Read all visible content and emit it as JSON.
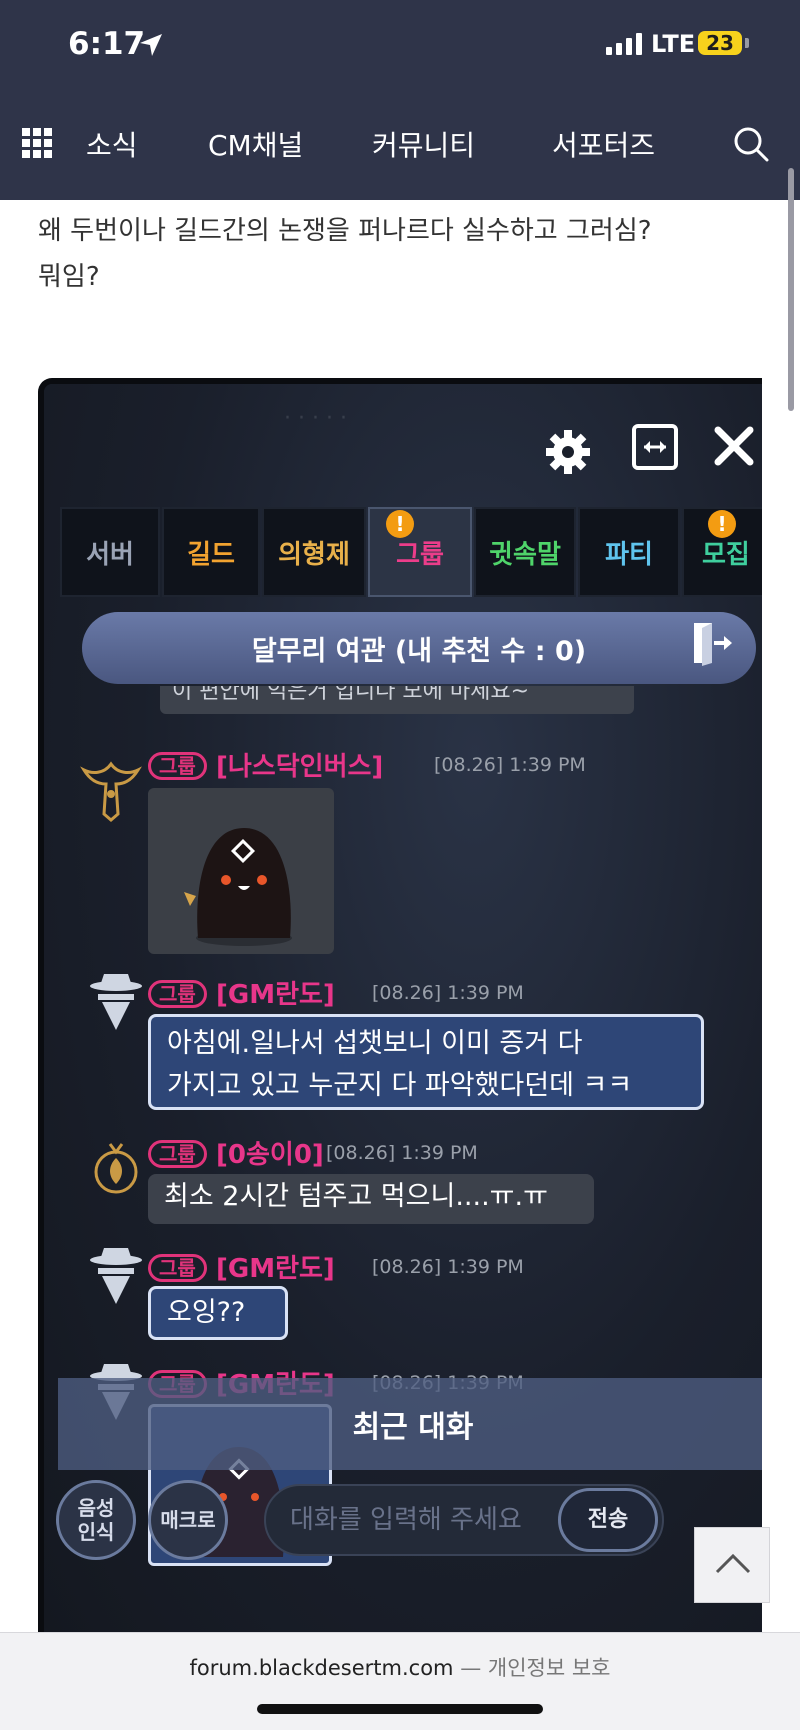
{
  "status": {
    "time": "6:17",
    "network": "LTE",
    "battery": "23"
  },
  "nav": {
    "items": [
      "소식",
      "CM채널",
      "커뮤니티",
      "서포터즈"
    ],
    "menu_icon": "grid-icon",
    "search_icon": "search-icon"
  },
  "post": {
    "line1": "왜 두번이나 길드간의 논쟁을 퍼나르다 실수하고 그러심?",
    "line2": "뭐임?"
  },
  "game": {
    "tabs": [
      {
        "label": "서버",
        "color": "#9aa3b5"
      },
      {
        "label": "길드",
        "color": "#f2a330"
      },
      {
        "label": "의형제",
        "color": "#e8b04a"
      },
      {
        "label": "그룹",
        "color": "#ec3d8a"
      },
      {
        "label": "귓속말",
        "color": "#4fd46a"
      },
      {
        "label": "파티",
        "color": "#5fc4ee"
      },
      {
        "label": "모집",
        "color": "#3fcf9e"
      }
    ],
    "room_title": "달무리 여관 (내 추천 수 : 0)",
    "cut_message": "이 편안에 익은거 입니다 모에 마세요~",
    "group_tag": "그룹",
    "messages": [
      {
        "name": "[나스닥인버스]",
        "time": "[08.26] 1:39 PM"
      },
      {
        "name": "[GM란도]",
        "time": "[08.26] 1:39 PM",
        "text_line1": "아침에.일나서 섭챗보니 이미 증거 다",
        "text_line2": "가지고 있고 누군지 다 파악했다던데 ㅋㅋ"
      },
      {
        "name": "[0송이0]",
        "time": "[08.26] 1:39 PM",
        "text": "최소 2시간 텀주고 먹으니....ㅠ.ㅠ"
      },
      {
        "name": "[GM란도]",
        "time": "[08.26] 1:39 PM",
        "text": "오잉??"
      },
      {
        "name": "[GM란도]",
        "time": "[08.26] 1:39 PM"
      }
    ],
    "recent_label": "최근 대화",
    "bottom": {
      "voice_label": "음성인식",
      "macro_label": "매크로",
      "input_placeholder": "대화를 입력해 주세요",
      "send_label": "전송"
    }
  },
  "browser": {
    "domain": "forum.blackdesertm.com",
    "privacy": "— 개인정보 보호"
  }
}
